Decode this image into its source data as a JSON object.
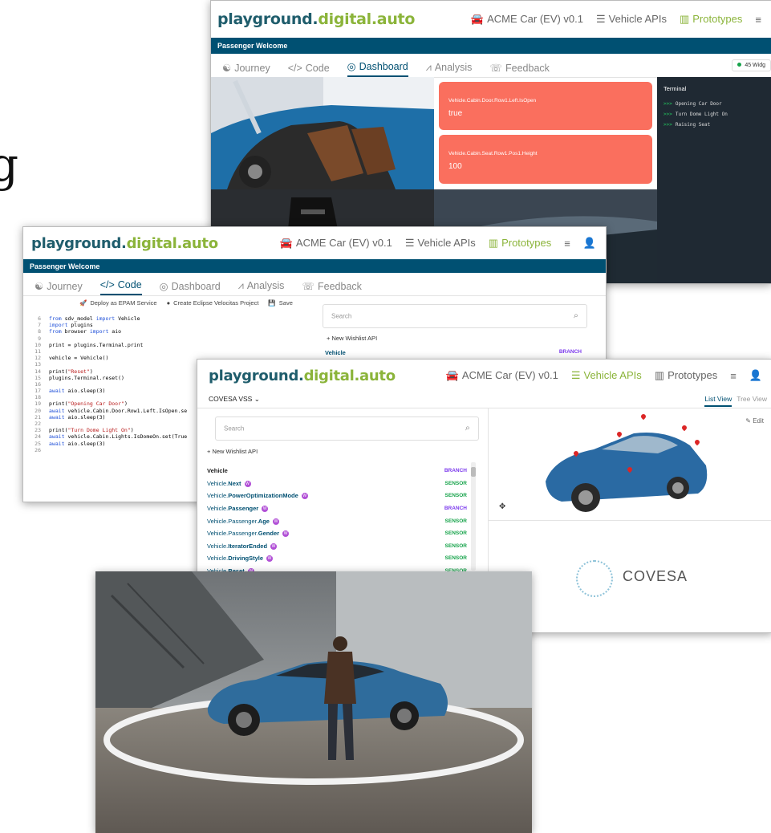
{
  "brand": {
    "part1": "playground.",
    "part2": "digital.auto"
  },
  "nav": {
    "car": "ACME Car (EV) v0.1",
    "apis": "Vehicle APIs",
    "prototypes": "Prototypes"
  },
  "edge_glyph": "g",
  "prototype_title": "Passenger Welcome",
  "tabs": {
    "journey": "Journey",
    "code": "Code",
    "dashboard": "Dashboard",
    "analysis": "Analysis",
    "feedback": "Feedback"
  },
  "dashboard": {
    "widgets_badge": "45 Widg",
    "cards": [
      {
        "label": "Vehicle.Cabin.Door.Row1.Left.IsOpen",
        "value": "true"
      },
      {
        "label": "Vehicle.Cabin.Seat.Row1.Pos1.Height",
        "value": "100"
      }
    ],
    "terminal": {
      "title": "Terminal",
      "prompt": ">>>",
      "lines": [
        "Opening Car Door",
        "Turn Dome Light On",
        "Raising Seat"
      ]
    }
  },
  "code_view": {
    "toolbar": {
      "deploy": "Deploy as EPAM Service",
      "velocitas": "Create Eclipse Velocitas Project",
      "save": "Save"
    },
    "search_placeholder": "Search",
    "new_wishlist": "New Wishlist API",
    "api_root": {
      "name": "Vehicle",
      "type": "BRANCH"
    },
    "lines": [
      {
        "n": "6",
        "t": "from sdv_model import Vehicle"
      },
      {
        "n": "7",
        "t": "import plugins"
      },
      {
        "n": "8",
        "t": "from browser import aio"
      },
      {
        "n": "9",
        "t": ""
      },
      {
        "n": "10",
        "t": "print = plugins.Terminal.print"
      },
      {
        "n": "11",
        "t": ""
      },
      {
        "n": "12",
        "t": "vehicle = Vehicle()"
      },
      {
        "n": "13",
        "t": ""
      },
      {
        "n": "14",
        "t": "print(\"Reset\")"
      },
      {
        "n": "15",
        "t": "plugins.Terminal.reset()"
      },
      {
        "n": "16",
        "t": ""
      },
      {
        "n": "17",
        "t": "await aio.sleep(3)"
      },
      {
        "n": "18",
        "t": ""
      },
      {
        "n": "19",
        "t": "print(\"Opening Car Door\")"
      },
      {
        "n": "20",
        "t": "await vehicle.Cabin.Door.Row1.Left.IsOpen.se"
      },
      {
        "n": "21",
        "t": "await aio.sleep(3)"
      },
      {
        "n": "22",
        "t": ""
      },
      {
        "n": "23",
        "t": "print(\"Turn Dome Light On\")"
      },
      {
        "n": "24",
        "t": "await vehicle.Cabin.Lights.IsDomeOn.set(True"
      },
      {
        "n": "25",
        "t": "await aio.sleep(3)"
      },
      {
        "n": "26",
        "t": ""
      }
    ]
  },
  "api_view": {
    "standard": "COVESA VSS",
    "view_list": "List View",
    "view_tree": "Tree View",
    "edit": "Edit",
    "search_placeholder": "Search",
    "new_wishlist": "New Wishlist API",
    "wishlist_badge": "W",
    "covesa_logo": "COVESA",
    "rows": [
      {
        "prefix": "Vehicle",
        "leaf": "",
        "type": "BRANCH",
        "w": false
      },
      {
        "prefix": "Vehicle.",
        "leaf": "Next",
        "type": "SENSOR",
        "w": true
      },
      {
        "prefix": "Vehicle.",
        "leaf": "PowerOptimizationMode",
        "type": "SENSOR",
        "w": true
      },
      {
        "prefix": "Vehicle.",
        "leaf": "Passenger",
        "type": "BRANCH",
        "w": true
      },
      {
        "prefix": "Vehicle.Passenger.",
        "leaf": "Age",
        "type": "SENSOR",
        "w": true
      },
      {
        "prefix": "Vehicle.Passenger.",
        "leaf": "Gender",
        "type": "SENSOR",
        "w": true
      },
      {
        "prefix": "Vehicle.",
        "leaf": "IteratorEnded",
        "type": "SENSOR",
        "w": true
      },
      {
        "prefix": "Vehicle.",
        "leaf": "DrivingStyle",
        "type": "SENSOR",
        "w": true
      },
      {
        "prefix": "Vehicle.",
        "leaf": "Reset",
        "type": "SENSOR",
        "w": true
      }
    ]
  },
  "colors": {
    "brand_dark": "#1f5d6c",
    "brand_green": "#8bb43a",
    "title_bar": "#005072",
    "card": "#fa6f5e",
    "terminal_bg": "#1f2933"
  }
}
